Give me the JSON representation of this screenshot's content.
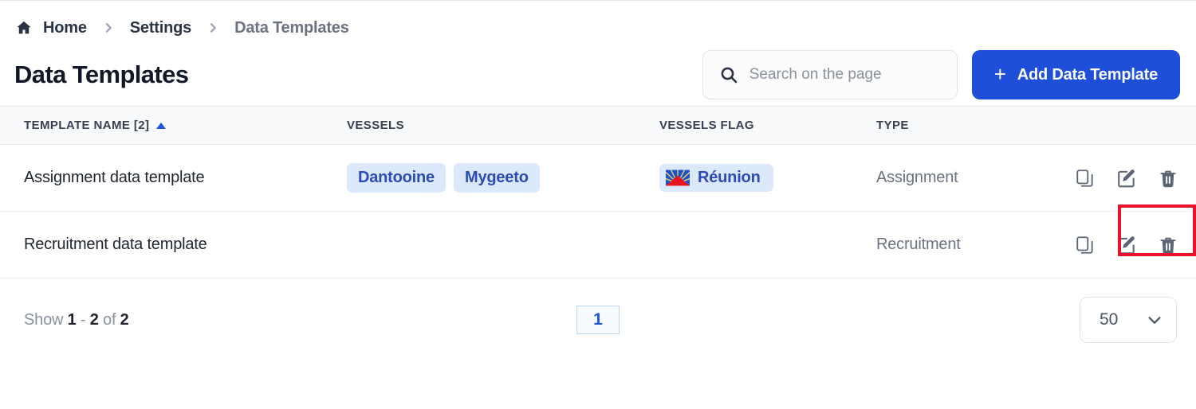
{
  "breadcrumb": {
    "home_icon": "home-icon",
    "separator_icon": "chevron-right-icon",
    "items": [
      {
        "label": "Home"
      },
      {
        "label": "Settings"
      },
      {
        "label": "Data Templates"
      }
    ]
  },
  "header": {
    "title": "Data Templates",
    "search": {
      "icon": "search-icon",
      "placeholder": "Search on the page",
      "value": ""
    },
    "add_button": {
      "icon": "plus-icon",
      "label": "Add Data Template",
      "color": "#1f4fd8"
    }
  },
  "table": {
    "columns": [
      {
        "label": "Template Name [2]",
        "sort": "asc",
        "sort_icon": "caret-up-icon",
        "sort_color": "#2156d6"
      },
      {
        "label": "Vessels"
      },
      {
        "label": "Vessels Flag"
      },
      {
        "label": "Type"
      },
      {
        "label": ""
      }
    ],
    "rows": [
      {
        "name": "Assignment data template",
        "vessels": [
          "Dantooine",
          "Mygeeto"
        ],
        "flags": [
          {
            "label": "Réunion",
            "icon": "flag-reunion-icon"
          }
        ],
        "type": "Assignment",
        "actions": [
          {
            "name": "copy-button",
            "icon": "copy-icon"
          },
          {
            "name": "edit-button",
            "icon": "edit-icon"
          },
          {
            "name": "delete-button",
            "icon": "trash-icon"
          }
        ]
      },
      {
        "name": "Recruitment data template",
        "vessels": [],
        "flags": [],
        "type": "Recruitment",
        "actions": [
          {
            "name": "copy-button",
            "icon": "copy-icon"
          },
          {
            "name": "edit-button",
            "icon": "edit-icon"
          },
          {
            "name": "delete-button",
            "icon": "trash-icon"
          }
        ]
      }
    ]
  },
  "footer": {
    "show_prefix": "Show",
    "range_start": "1",
    "range_dash": "-",
    "range_end": "2",
    "of_word": "of",
    "total": "2",
    "pages": [
      {
        "label": "1",
        "active": true
      }
    ],
    "page_size": {
      "value": "50",
      "chevron_icon": "chevron-down-icon"
    }
  },
  "annotation": {
    "highlight_color": "#e8132b",
    "target": "row-actions-edit-delete"
  },
  "chip_colors": {
    "vessel_bg": "#dce8fc",
    "vessel_text": "#2b4bb5"
  }
}
